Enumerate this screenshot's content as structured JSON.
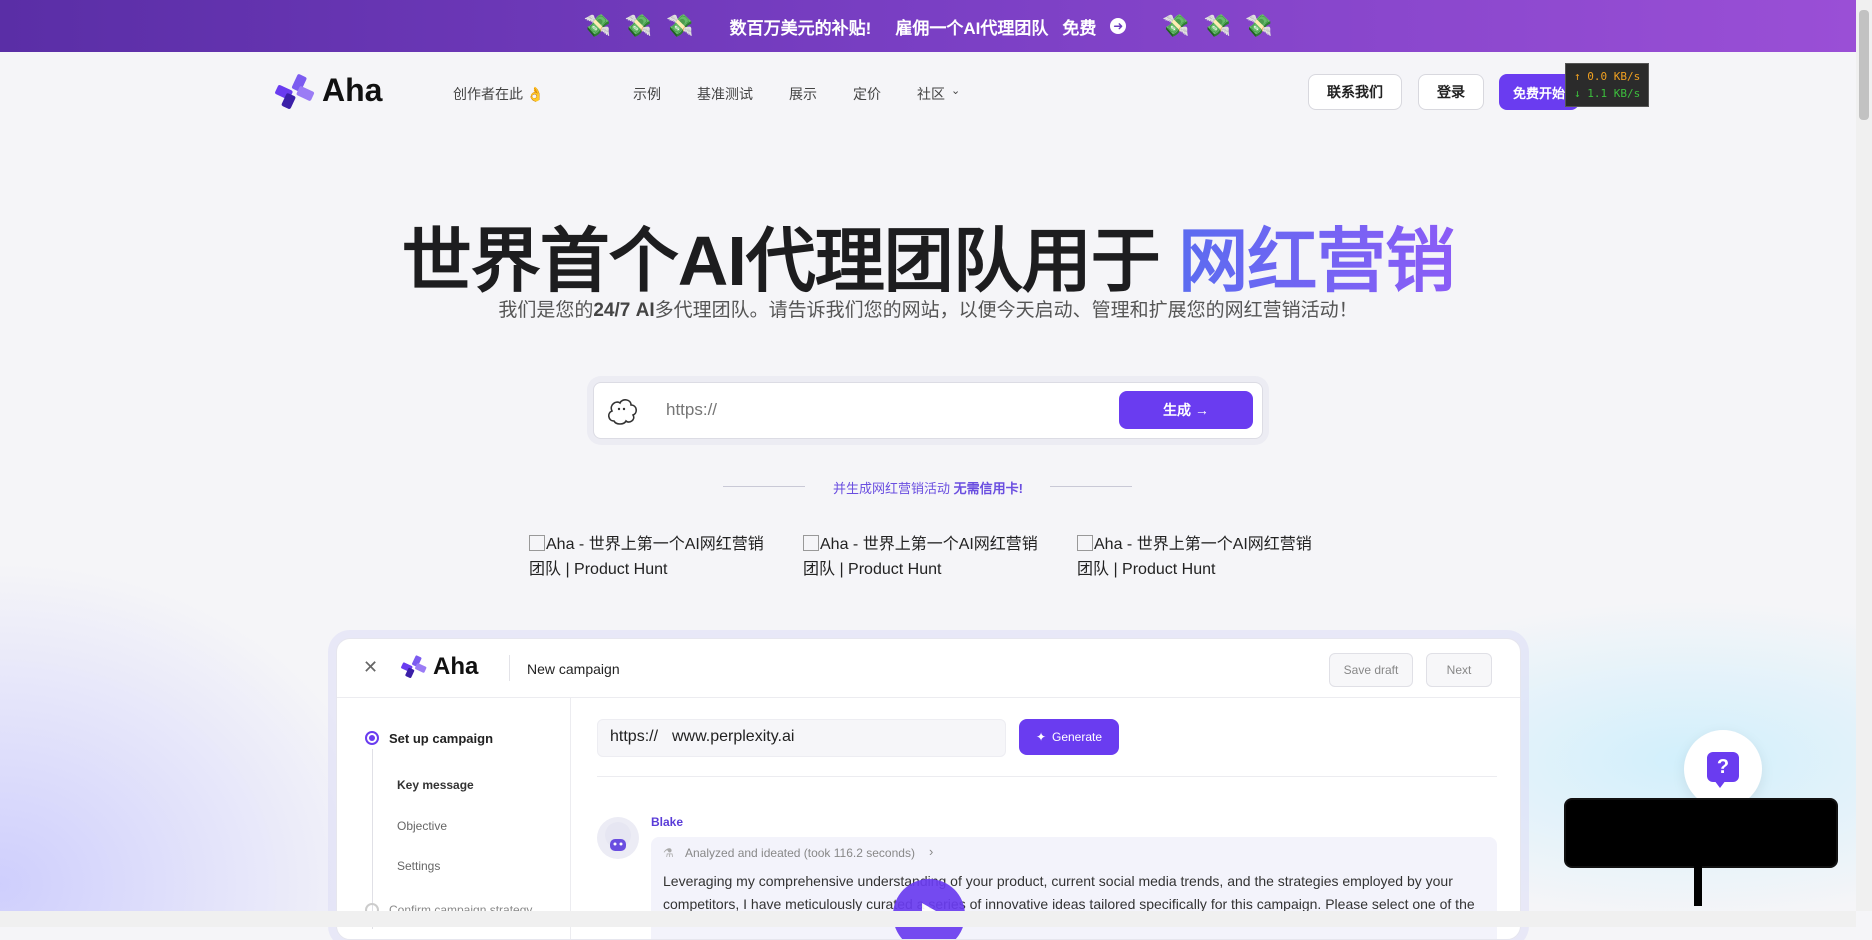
{
  "banner": {
    "money_icon": "💸",
    "promo_text": "数百万美元的补贴!",
    "hire_text": "雇佣一个AI代理团队",
    "free_text": "免费"
  },
  "nav": {
    "brand": "Aha",
    "creator_link": "创作者在此 👌",
    "links": [
      "示例",
      "基准测试",
      "展示",
      "定价",
      "社区"
    ],
    "contact": "联系我们",
    "login": "登录",
    "signup": "免费开始"
  },
  "speed": {
    "up": "↑ 0.0 KB/s",
    "down": "↓ 1.1 KB/s"
  },
  "hero": {
    "title_main": "世界首个AI代理团队用于",
    "title_accent": "网红营销",
    "subtitle_pre": "我们是您的",
    "subtitle_bold": "24/7 AI",
    "subtitle_post": "多代理团队。请告诉我们您的网站，以便今天启动、管理和扩展您的网红营销活动！"
  },
  "search": {
    "placeholder": "https://",
    "button": "生成 →"
  },
  "promo": {
    "text": "并生成网红营销活动",
    "bold": "无需信用卡!"
  },
  "product_hunt": [
    "Aha - 世界上第一个AI网红营销团队 | Product Hunt",
    "Aha - 世界上第一个AI网红营销团队 | Product Hunt",
    "Aha - 世界上第一个AI网红营销团队 | Product Hunt"
  ],
  "app": {
    "brand": "Aha",
    "title": "New campaign",
    "save_draft": "Save draft",
    "next": "Next",
    "steps": [
      "Set up campaign",
      "Key message",
      "Objective",
      "Settings",
      "Confirm campaign strategy"
    ],
    "url_prefix": "https://",
    "url_value": "www.perplexity.ai",
    "generate": "Generate",
    "agent_name": "Blake",
    "analysis": "Analyzed and ideated (took 116.2 seconds)",
    "message_line1": "Leveraging my comprehensive understanding of your product, current social media trends, and the strategies employed by your",
    "message_line2": "competitors, I have meticulously curated a series of innovative ideas tailored specifically for this campaign. Please select one of the"
  },
  "help": {
    "icon": "?"
  },
  "colors": {
    "accent": "#6a3cf0",
    "banner": "#7a3fc4"
  }
}
